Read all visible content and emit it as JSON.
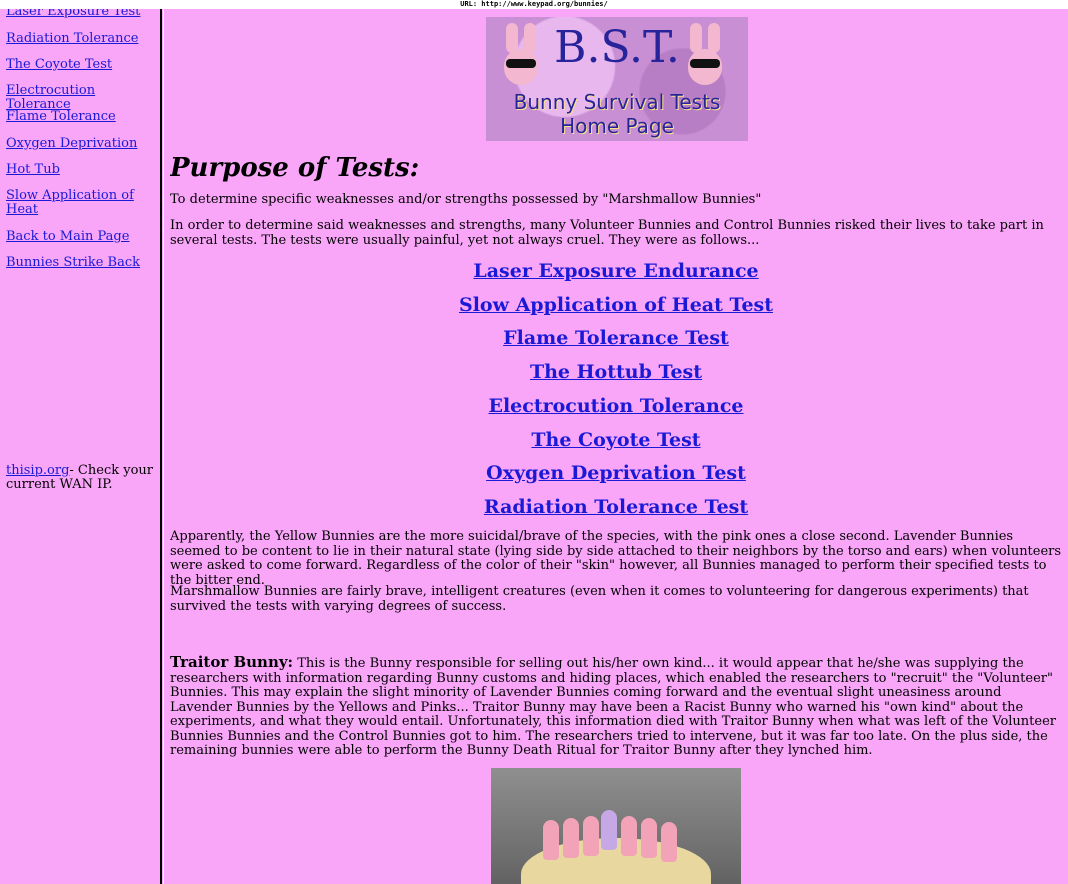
{
  "browser": {
    "url_text": "URL: http://www.keypad.org/bunnies/"
  },
  "sidebar": {
    "links": [
      "Laser Exposure Test",
      "Radiation Tolerance",
      "The Coyote Test",
      "Electrocution Tolerance",
      "Flame Tolerance",
      "Oxygen Deprivation",
      "Hot Tub",
      "Slow Application of Heat",
      "Back to Main Page",
      "Bunnies Strike Back"
    ],
    "thisip_link": "thisip.org",
    "thisip_text": "- Check your current WAN IP."
  },
  "logo": {
    "title": "B.S.T.",
    "subtitle_line1": "Bunny Survival Tests",
    "subtitle_line2": "Home Page"
  },
  "main": {
    "heading": "Purpose of Tests:",
    "intro1": "To determine specific weaknesses and/or strengths possessed by \"Marshmallow Bunnies\"",
    "intro2": "In order to determine said weaknesses and strengths, many Volunteer Bunnies and Control Bunnies risked their lives to take part in several tests. The tests were usually painful, yet not always cruel. They were as follows...",
    "tests": [
      "Laser Exposure Endurance",
      "Slow Application of Heat Test",
      "Flame Tolerance Test",
      "The Hottub Test",
      "Electrocution Tolerance",
      "The Coyote Test",
      "Oxygen Deprivation Test",
      "Radiation Tolerance Test"
    ],
    "para3": "Apparently, the Yellow Bunnies are the more suicidal/brave of the species, with the pink ones a close second. Lavender Bunnies seemed to be content to lie in their natural state (lying side by side attached to their neighbors by the torso and ears) when volunteers were asked to come forward. Regardless of the color of their \"skin\" however, all Bunnies managed to perform their specified tests to the bitter end.",
    "para4": "Marshmallow Bunnies are fairly brave, intelligent creatures (even when it comes to volunteering for dangerous experiments) that survived the tests with varying degrees of success.",
    "traitor_label": "Traitor Bunny:",
    "traitor_text": " This is the Bunny responsible for selling out his/her own kind... it would appear that he/she was supplying the researchers with information regarding Bunny customs and hiding places, which enabled the researchers to \"recruit\" the \"Volunteer\" Bunnies. This may explain the slight minority of Lavender Bunnies coming forward and the eventual slight uneasiness around Lavender Bunnies by the Yellows and Pinks... Traitor Bunny may have been a Racist Bunny who warned his \"own kind\" about the experiments, and what they would entail. Unfortunately, this information died with Traitor Bunny when what was left of the Volunteer Bunnies Bunnies and the Control Bunnies got to him. The researchers tried to intervene, but it was far too late. On the plus side, the remaining bunnies were able to perform the Bunny Death Ritual for Traitor Bunny after they lynched him."
  },
  "colors": {
    "background": "#f9a6f9",
    "link": "#1a1ad6",
    "logo_text": "#27239a"
  }
}
